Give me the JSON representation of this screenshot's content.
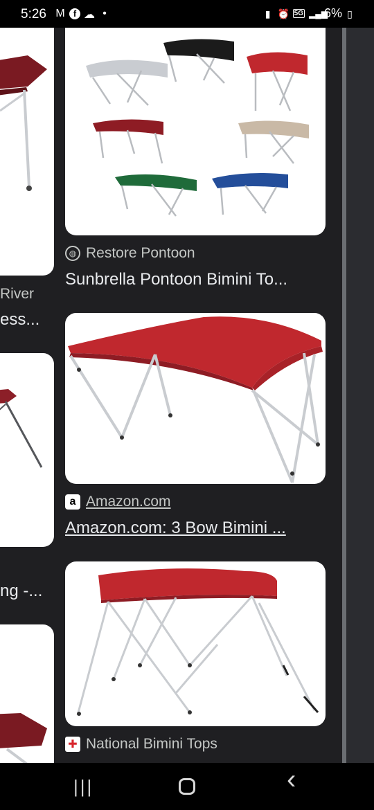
{
  "status_bar": {
    "time": "5:26",
    "notif_icons": [
      "gmail-icon",
      "facebook-icon",
      "cloud-icon"
    ],
    "dot": "•",
    "signal_label": "5G",
    "battery": "6%"
  },
  "left_column": {
    "source_partial": "River",
    "title_partial": "ess...",
    "title2_partial": "ng -..."
  },
  "results": [
    {
      "source": "Restore Pontoon",
      "title": "Sunbrella Pontoon Bimini To...",
      "favicon": "globe-icon"
    },
    {
      "source": "Amazon.com",
      "title": "Amazon.com: 3 Bow Bimini ...",
      "favicon": "amazon-icon"
    },
    {
      "source": "National Bimini Tops",
      "title": "",
      "favicon": "national-bimini-icon"
    }
  ],
  "nav": {
    "recents": "|||",
    "back": "‹"
  },
  "colors": {
    "canopy_red": "#b8282e",
    "dark_red": "#7a1a22",
    "frame": "#c9ccd0"
  }
}
